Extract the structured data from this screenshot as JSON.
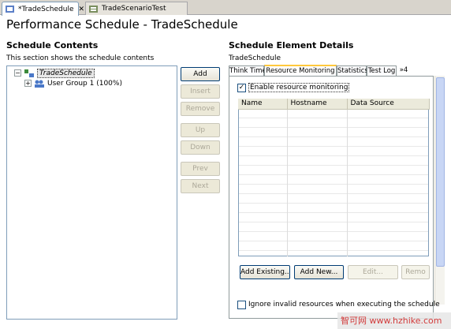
{
  "tabs": [
    {
      "label": "*TradeSchedule",
      "close": "✕"
    },
    {
      "label": "TradeScenarioTest"
    }
  ],
  "page_title": "Performance Schedule - TradeSchedule",
  "left": {
    "title": "Schedule Contents",
    "description": "This section shows the schedule contents",
    "tree": {
      "root": {
        "label": "TradeSchedule",
        "expander": "−"
      },
      "child": {
        "label": "User Group 1 (100%)",
        "expander": "+"
      }
    },
    "buttons": [
      "Add",
      "Insert",
      "Remove",
      "Up",
      "Down",
      "Prev",
      "Next"
    ]
  },
  "right": {
    "title": "Schedule Element Details",
    "element_name": "TradeSchedule",
    "tabs": [
      "Think Time",
      "Resource Monitoring",
      "Statistics",
      "Test Log",
      "»4"
    ],
    "enable_label": "Enable resource monitoring",
    "enable_checked": "✓",
    "columns": [
      "Name",
      "Hostname",
      "Data Source"
    ],
    "buttons": [
      "Add Existing...",
      "Add New...",
      "Edit...",
      "Remo"
    ],
    "ignore_label": "Ignore invalid resources when executing the schedule",
    "ignore_checked": ""
  },
  "watermark": "智可网 www.hzhike.com",
  "colors": {
    "accent_tab": "#ffc83c",
    "border": "#7f9db9",
    "button_border": "#003c74"
  }
}
